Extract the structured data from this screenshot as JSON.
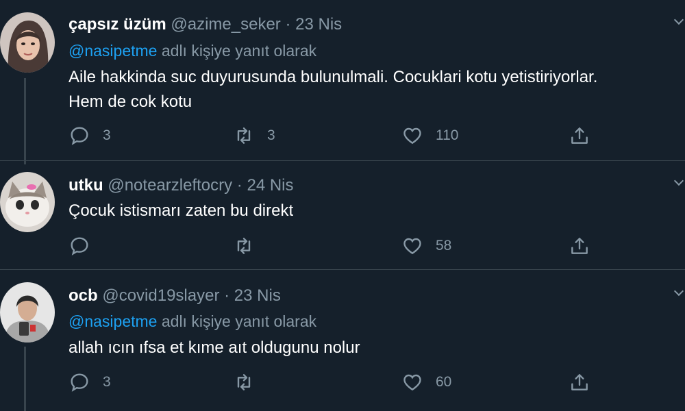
{
  "tweets": [
    {
      "display_name": "çapsız üzüm",
      "handle": "@azime_seker",
      "separator": "·",
      "date": "23 Nis",
      "reply_mention": "@nasipetme",
      "reply_suffix": " adlı kişiye yanıt olarak",
      "text_lines": [
        "Aile hakkinda suc duyurusunda bulunulmali. Cocuklari kotu yetistiriyorlar.",
        "Hem de cok kotu"
      ],
      "reply_count": "3",
      "retweet_count": "3",
      "like_count": "110",
      "avatar_icon": "user-avatar-woman"
    },
    {
      "display_name": "utku",
      "handle": "@notearzleftocry",
      "separator": "·",
      "date": "24 Nis",
      "text_lines": [
        "Çocuk istismarı zaten bu direkt"
      ],
      "reply_count": "",
      "retweet_count": "",
      "like_count": "58",
      "avatar_icon": "user-avatar-kitten"
    },
    {
      "display_name": "ocb",
      "handle": "@covid19slayer",
      "separator": "·",
      "date": "23 Nis",
      "reply_mention": "@nasipetme",
      "reply_suffix": " adlı kişiye yanıt olarak",
      "text_lines": [
        "allah ıcın ıfsa et kıme aıt oldugunu nolur"
      ],
      "reply_count": "3",
      "retweet_count": "",
      "like_count": "60",
      "avatar_icon": "user-avatar-man"
    }
  ],
  "colors": {
    "background": "#15202b",
    "text": "#ffffff",
    "secondary": "#8899a6",
    "mention": "#1da1f2",
    "border": "#38444d"
  }
}
